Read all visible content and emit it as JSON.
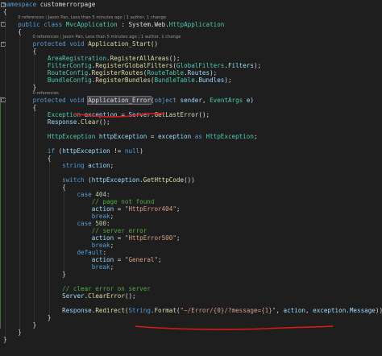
{
  "code_lens": {
    "class_lens": [
      "0 references",
      "Jason Pan, Less than 5 minutes ago",
      "1 author, 1 change"
    ],
    "start_lens": [
      "0 references",
      "Jason Pan, Less than 5 minutes ago",
      "1 author, 1 change"
    ],
    "error_lens": [
      "0 references"
    ]
  },
  "lines": [
    {
      "kind": "code",
      "segs": [
        [
          "kw",
          "namespace"
        ],
        [
          "pl",
          " customerrorpage"
        ]
      ]
    },
    {
      "kind": "code",
      "segs": [
        [
          "pl",
          "{"
        ]
      ]
    },
    {
      "kind": "lens",
      "key": "class_lens",
      "indent": 4
    },
    {
      "kind": "code",
      "segs": [
        [
          "pl",
          "    "
        ],
        [
          "kw",
          "public"
        ],
        [
          "pl",
          " "
        ],
        [
          "kw",
          "class"
        ],
        [
          "pl",
          " "
        ],
        [
          "ty",
          "MvcApplication"
        ],
        [
          "pl",
          " : System.Web."
        ],
        [
          "ty",
          "HttpApplication"
        ]
      ]
    },
    {
      "kind": "code",
      "segs": [
        [
          "pl",
          "    {"
        ]
      ]
    },
    {
      "kind": "lens",
      "key": "start_lens",
      "indent": 8
    },
    {
      "kind": "code",
      "segs": [
        [
          "pl",
          "        "
        ],
        [
          "kw",
          "protected"
        ],
        [
          "pl",
          " "
        ],
        [
          "kw",
          "void"
        ],
        [
          "pl",
          " "
        ],
        [
          "me",
          "Application_Start"
        ],
        [
          "pl",
          "()"
        ]
      ]
    },
    {
      "kind": "code",
      "segs": [
        [
          "pl",
          "        {"
        ]
      ]
    },
    {
      "kind": "code",
      "segs": [
        [
          "pl",
          "            "
        ],
        [
          "ty",
          "AreaRegistration"
        ],
        [
          "pl",
          "."
        ],
        [
          "me",
          "RegisterAllAreas"
        ],
        [
          "pl",
          "();"
        ]
      ]
    },
    {
      "kind": "code",
      "segs": [
        [
          "pl",
          "            "
        ],
        [
          "ty",
          "FilterConfig"
        ],
        [
          "pl",
          "."
        ],
        [
          "me",
          "RegisterGlobalFilters"
        ],
        [
          "pl",
          "("
        ],
        [
          "ty",
          "GlobalFilters"
        ],
        [
          "pl",
          "."
        ],
        [
          "va",
          "Filters"
        ],
        [
          "pl",
          ");"
        ]
      ]
    },
    {
      "kind": "code",
      "segs": [
        [
          "pl",
          "            "
        ],
        [
          "ty",
          "RouteConfig"
        ],
        [
          "pl",
          "."
        ],
        [
          "me",
          "RegisterRoutes"
        ],
        [
          "pl",
          "("
        ],
        [
          "ty",
          "RouteTable"
        ],
        [
          "pl",
          "."
        ],
        [
          "va",
          "Routes"
        ],
        [
          "pl",
          ");"
        ]
      ]
    },
    {
      "kind": "code",
      "segs": [
        [
          "pl",
          "            "
        ],
        [
          "ty",
          "BundleConfig"
        ],
        [
          "pl",
          "."
        ],
        [
          "me",
          "RegisterBundles"
        ],
        [
          "pl",
          "("
        ],
        [
          "ty",
          "BundleTable"
        ],
        [
          "pl",
          "."
        ],
        [
          "va",
          "Bundles"
        ],
        [
          "pl",
          ");"
        ]
      ]
    },
    {
      "kind": "code",
      "segs": [
        [
          "pl",
          "        }"
        ]
      ]
    },
    {
      "kind": "lens",
      "key": "error_lens",
      "indent": 8
    },
    {
      "kind": "code",
      "segs": [
        [
          "pl",
          "        "
        ],
        [
          "kw",
          "protected"
        ],
        [
          "pl",
          " "
        ],
        [
          "kw",
          "void"
        ],
        [
          "pl",
          " "
        ],
        [
          "hl",
          "Application_Error"
        ],
        [
          "pl",
          "("
        ],
        [
          "kw",
          "object"
        ],
        [
          "pl",
          " "
        ],
        [
          "va",
          "sender"
        ],
        [
          "pl",
          ", "
        ],
        [
          "ty",
          "EventArgs"
        ],
        [
          "pl",
          " "
        ],
        [
          "va",
          "e"
        ],
        [
          "pl",
          ")"
        ]
      ]
    },
    {
      "kind": "code",
      "segs": [
        [
          "pl",
          "        {"
        ]
      ]
    },
    {
      "kind": "code",
      "segs": [
        [
          "pl",
          "            "
        ],
        [
          "ty",
          "Exception"
        ],
        [
          "pl",
          " "
        ],
        [
          "va",
          "exception"
        ],
        [
          "pl",
          " = "
        ],
        [
          "va",
          "Server"
        ],
        [
          "pl",
          "."
        ],
        [
          "me",
          "GetLastError"
        ],
        [
          "pl",
          "();"
        ]
      ]
    },
    {
      "kind": "code",
      "segs": [
        [
          "pl",
          "            "
        ],
        [
          "va",
          "Response"
        ],
        [
          "pl",
          "."
        ],
        [
          "me",
          "Clear"
        ],
        [
          "pl",
          "();"
        ]
      ]
    },
    {
      "kind": "code",
      "segs": [
        [
          "pl",
          ""
        ]
      ]
    },
    {
      "kind": "code",
      "segs": [
        [
          "pl",
          "            "
        ],
        [
          "ty",
          "HttpException"
        ],
        [
          "pl",
          " "
        ],
        [
          "va",
          "httpException"
        ],
        [
          "pl",
          " = "
        ],
        [
          "va",
          "exception"
        ],
        [
          "pl",
          " "
        ],
        [
          "kw",
          "as"
        ],
        [
          "pl",
          " "
        ],
        [
          "ty",
          "HttpException"
        ],
        [
          "pl",
          ";"
        ]
      ]
    },
    {
      "kind": "code",
      "segs": [
        [
          "pl",
          ""
        ]
      ]
    },
    {
      "kind": "code",
      "segs": [
        [
          "pl",
          "            "
        ],
        [
          "kw",
          "if"
        ],
        [
          "pl",
          " ("
        ],
        [
          "va",
          "httpException"
        ],
        [
          "pl",
          " != "
        ],
        [
          "kw",
          "null"
        ],
        [
          "pl",
          ")"
        ]
      ]
    },
    {
      "kind": "code",
      "segs": [
        [
          "pl",
          "            {"
        ]
      ]
    },
    {
      "kind": "code",
      "segs": [
        [
          "pl",
          "                "
        ],
        [
          "kw",
          "string"
        ],
        [
          "pl",
          " "
        ],
        [
          "va",
          "action"
        ],
        [
          "pl",
          ";"
        ]
      ]
    },
    {
      "kind": "code",
      "segs": [
        [
          "pl",
          ""
        ]
      ]
    },
    {
      "kind": "code",
      "segs": [
        [
          "pl",
          "                "
        ],
        [
          "kw",
          "switch"
        ],
        [
          "pl",
          " ("
        ],
        [
          "va",
          "httpException"
        ],
        [
          "pl",
          "."
        ],
        [
          "me",
          "GetHttpCode"
        ],
        [
          "pl",
          "())"
        ]
      ]
    },
    {
      "kind": "code",
      "segs": [
        [
          "pl",
          "                {"
        ]
      ]
    },
    {
      "kind": "code",
      "segs": [
        [
          "pl",
          "                    "
        ],
        [
          "kw",
          "case"
        ],
        [
          "pl",
          " "
        ],
        [
          "nu",
          "404"
        ],
        [
          "pl",
          ":"
        ]
      ]
    },
    {
      "kind": "code",
      "segs": [
        [
          "pl",
          "                        "
        ],
        [
          "cm",
          "// page not found"
        ]
      ]
    },
    {
      "kind": "code",
      "segs": [
        [
          "pl",
          "                        "
        ],
        [
          "va",
          "action"
        ],
        [
          "pl",
          " = "
        ],
        [
          "st",
          "\"HttpError404\""
        ],
        [
          "pl",
          ";"
        ]
      ]
    },
    {
      "kind": "code",
      "segs": [
        [
          "pl",
          "                        "
        ],
        [
          "kw",
          "break"
        ],
        [
          "pl",
          ";"
        ]
      ]
    },
    {
      "kind": "code",
      "segs": [
        [
          "pl",
          "                    "
        ],
        [
          "kw",
          "case"
        ],
        [
          "pl",
          " "
        ],
        [
          "nu",
          "500"
        ],
        [
          "pl",
          ":"
        ]
      ]
    },
    {
      "kind": "code",
      "segs": [
        [
          "pl",
          "                        "
        ],
        [
          "cm",
          "// server error"
        ]
      ]
    },
    {
      "kind": "code",
      "segs": [
        [
          "pl",
          "                        "
        ],
        [
          "va",
          "action"
        ],
        [
          "pl",
          " = "
        ],
        [
          "st",
          "\"HttpError500\""
        ],
        [
          "pl",
          ";"
        ]
      ]
    },
    {
      "kind": "code",
      "segs": [
        [
          "pl",
          "                        "
        ],
        [
          "kw",
          "break"
        ],
        [
          "pl",
          ";"
        ]
      ]
    },
    {
      "kind": "code",
      "segs": [
        [
          "pl",
          "                    "
        ],
        [
          "kw",
          "default"
        ],
        [
          "pl",
          ":"
        ]
      ]
    },
    {
      "kind": "code",
      "segs": [
        [
          "pl",
          "                        "
        ],
        [
          "va",
          "action"
        ],
        [
          "pl",
          " = "
        ],
        [
          "st",
          "\"General\""
        ],
        [
          "pl",
          ";"
        ]
      ]
    },
    {
      "kind": "code",
      "segs": [
        [
          "pl",
          "                        "
        ],
        [
          "kw",
          "break"
        ],
        [
          "pl",
          ";"
        ]
      ]
    },
    {
      "kind": "code",
      "segs": [
        [
          "pl",
          "                }"
        ]
      ]
    },
    {
      "kind": "code",
      "segs": [
        [
          "pl",
          ""
        ]
      ]
    },
    {
      "kind": "code",
      "segs": [
        [
          "pl",
          "                "
        ],
        [
          "cm",
          "// clear error on server"
        ]
      ]
    },
    {
      "kind": "code",
      "segs": [
        [
          "pl",
          "                "
        ],
        [
          "va",
          "Server"
        ],
        [
          "pl",
          "."
        ],
        [
          "me",
          "ClearError"
        ],
        [
          "pl",
          "();"
        ]
      ]
    },
    {
      "kind": "code",
      "segs": [
        [
          "pl",
          ""
        ]
      ]
    },
    {
      "kind": "code",
      "segs": [
        [
          "pl",
          "                "
        ],
        [
          "va",
          "Response"
        ],
        [
          "pl",
          "."
        ],
        [
          "me",
          "Redirect"
        ],
        [
          "pl",
          "("
        ],
        [
          "kw",
          "String"
        ],
        [
          "pl",
          "."
        ],
        [
          "me",
          "Format"
        ],
        [
          "pl",
          "("
        ],
        [
          "st",
          "\"~/Error/{0}/?message={1}\""
        ],
        [
          "pl",
          ", "
        ],
        [
          "va",
          "action"
        ],
        [
          "pl",
          ", "
        ],
        [
          "va",
          "exception"
        ],
        [
          "pl",
          "."
        ],
        [
          "va",
          "Message"
        ],
        [
          "pl",
          "));"
        ]
      ]
    },
    {
      "kind": "code",
      "segs": [
        [
          "pl",
          "            }"
        ]
      ]
    },
    {
      "kind": "code",
      "segs": [
        [
          "pl",
          "        }"
        ]
      ]
    },
    {
      "kind": "code",
      "segs": [
        [
          "pl",
          "    }"
        ]
      ]
    },
    {
      "kind": "code",
      "segs": [
        [
          "pl",
          "}"
        ]
      ]
    }
  ],
  "colors": {
    "background": "#1e1e1e",
    "keyword": "#569cd6",
    "type": "#4ec9b0",
    "method": "#dcdcaa",
    "variable": "#9cdcfe",
    "string": "#d69d85",
    "number": "#b5cea8",
    "comment": "#57a64a",
    "annotation": "#e0181a"
  },
  "outlining_icons": [
    "collapse-icon",
    "collapse-icon",
    "collapse-icon",
    "collapse-icon"
  ]
}
